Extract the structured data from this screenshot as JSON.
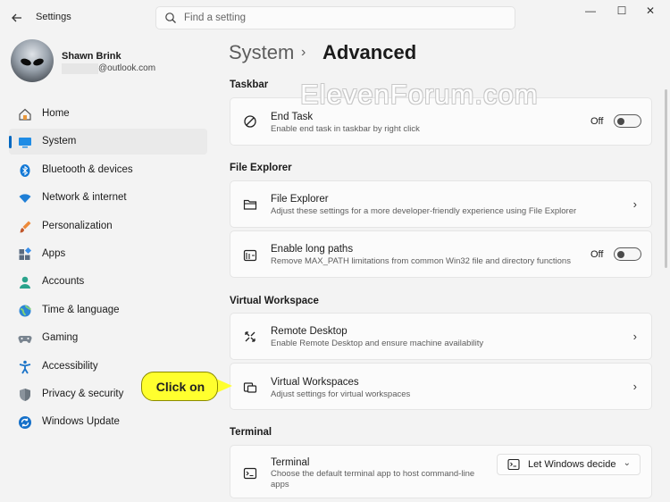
{
  "window": {
    "app_title": "Settings",
    "controls": {
      "minimize": "—",
      "maximize": "☐",
      "close": "✕"
    }
  },
  "search": {
    "placeholder": "Find a setting"
  },
  "profile": {
    "name": "Shawn Brink",
    "email_suffix": "@outlook.com"
  },
  "sidebar": {
    "items": [
      {
        "label": "Home",
        "icon": "home-icon"
      },
      {
        "label": "System",
        "icon": "system-icon",
        "active": true
      },
      {
        "label": "Bluetooth & devices",
        "icon": "bluetooth-icon"
      },
      {
        "label": "Network & internet",
        "icon": "wifi-icon"
      },
      {
        "label": "Personalization",
        "icon": "brush-icon"
      },
      {
        "label": "Apps",
        "icon": "apps-icon"
      },
      {
        "label": "Accounts",
        "icon": "accounts-icon"
      },
      {
        "label": "Time & language",
        "icon": "globe-icon"
      },
      {
        "label": "Gaming",
        "icon": "gamepad-icon"
      },
      {
        "label": "Accessibility",
        "icon": "accessibility-icon"
      },
      {
        "label": "Privacy & security",
        "icon": "shield-icon"
      },
      {
        "label": "Windows Update",
        "icon": "update-icon"
      }
    ]
  },
  "breadcrumb": {
    "parent": "System",
    "separator": "›",
    "current": "Advanced"
  },
  "watermark": "ElevenForum.com",
  "sections": {
    "taskbar": {
      "title": "Taskbar",
      "end_task": {
        "title": "End Task",
        "desc": "Enable end task in taskbar by right click",
        "state": "Off"
      }
    },
    "file_explorer": {
      "title": "File Explorer",
      "file_explorer": {
        "title": "File Explorer",
        "desc": "Adjust these settings for a more developer-friendly experience using File Explorer"
      },
      "long_paths": {
        "title": "Enable long paths",
        "desc": "Remove MAX_PATH limitations from common Win32 file and directory functions",
        "state": "Off"
      }
    },
    "virtual_workspace": {
      "title": "Virtual Workspace",
      "remote_desktop": {
        "title": "Remote Desktop",
        "desc": "Enable Remote Desktop and ensure machine availability"
      },
      "virtual_workspaces": {
        "title": "Virtual Workspaces",
        "desc": "Adjust settings for virtual workspaces"
      }
    },
    "terminal": {
      "title": "Terminal",
      "terminal": {
        "title": "Terminal",
        "desc": "Choose the default terminal app to host command-line apps",
        "dropdown_value": "Let Windows decide"
      }
    }
  },
  "callout": {
    "label": "Click on"
  },
  "colors": {
    "accent": "#0067c0",
    "callout": "#ffff2e"
  }
}
